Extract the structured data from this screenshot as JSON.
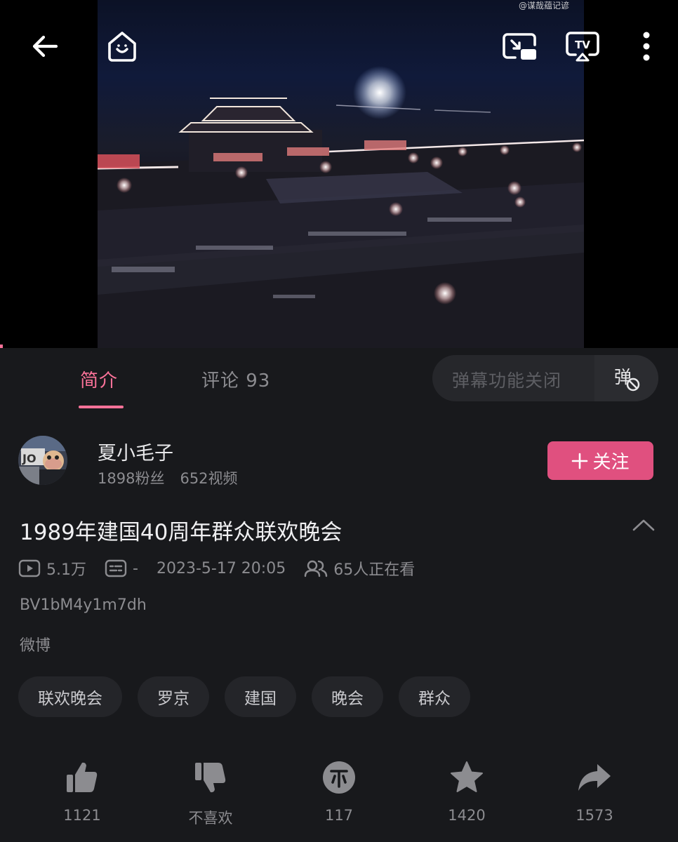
{
  "player": {
    "watermark": "@谋哉蕴记谚",
    "icons": [
      "back-arrow-icon",
      "home-icon",
      "picture-in-picture-icon",
      "tv-cast-icon",
      "more-vertical-icon"
    ]
  },
  "tabs": {
    "intro": "简介",
    "comments": "评论 93",
    "danmaku_placeholder": "弹幕功能关闭",
    "danmaku_toggle_glyph": "弹"
  },
  "uploader": {
    "name": "夏小毛子",
    "fans": "1898粉丝",
    "videos": "652视频",
    "follow_label": "关注"
  },
  "video": {
    "title": "1989年建国40周年群众联欢晚会",
    "views": "5.1万",
    "danmaku_count": "-",
    "date": "2023-5-17 20:05",
    "watching": "65人正在看",
    "bvid": "BV1bM4y1m7dh",
    "source": "微博"
  },
  "tags": [
    "联欢晚会",
    "罗京",
    "建国",
    "晚会",
    "群众"
  ],
  "actions": {
    "like": "1121",
    "dislike": "不喜欢",
    "coin": "117",
    "favorite": "1420",
    "share": "1573"
  },
  "colors": {
    "accent": "#fb7299",
    "follow_button": "#e0507f",
    "background": "#18191c"
  }
}
